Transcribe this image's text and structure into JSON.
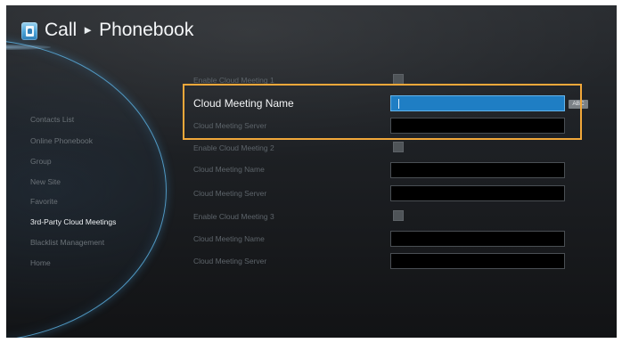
{
  "header": {
    "section": "Call",
    "separator": "►",
    "page": "Phonebook",
    "icon": "phonebook-icon"
  },
  "sidebar": {
    "items": [
      {
        "label": "Contacts List",
        "active": false
      },
      {
        "label": "Online Phonebook",
        "active": false
      },
      {
        "label": "Group",
        "active": false
      },
      {
        "label": "New Site",
        "active": false
      },
      {
        "label": "Favorite",
        "active": false
      },
      {
        "label": "3rd-Party Cloud Meetings",
        "active": true
      },
      {
        "label": "Blacklist Management",
        "active": false
      },
      {
        "label": "Home",
        "active": false
      }
    ]
  },
  "settings": {
    "rows": [
      {
        "label": "Enable Cloud Meeting 1",
        "control": "checkbox",
        "value": ""
      },
      {
        "label": "Cloud Meeting Name",
        "control": "text",
        "value": "",
        "focused": true
      },
      {
        "label": "Cloud Meeting Server",
        "control": "text",
        "value": ""
      },
      {
        "label": "Enable Cloud Meeting 2",
        "control": "checkbox",
        "value": ""
      },
      {
        "label": "Cloud Meeting Name",
        "control": "text",
        "value": ""
      },
      {
        "label": "Cloud Meeting Server",
        "control": "text",
        "value": ""
      },
      {
        "label": "Enable Cloud Meeting 3",
        "control": "checkbox",
        "value": ""
      },
      {
        "label": "Cloud Meeting Name",
        "control": "text",
        "value": ""
      },
      {
        "label": "Cloud Meeting Server",
        "control": "text",
        "value": ""
      }
    ],
    "input_mode_badge": "ABC"
  },
  "colors": {
    "accent": "#1f7ec4",
    "highlight": "#f2a83a",
    "arc": "#5aafe1"
  }
}
